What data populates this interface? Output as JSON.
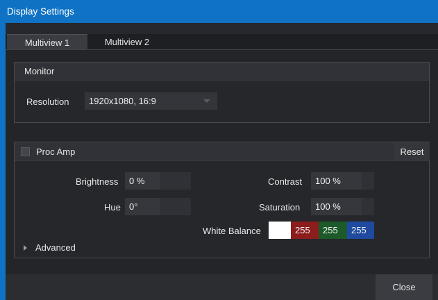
{
  "window": {
    "title": "Display Settings"
  },
  "tabs": [
    {
      "label": "Multiview 1",
      "active": true
    },
    {
      "label": "Multiview 2",
      "active": false
    }
  ],
  "monitor": {
    "title": "Monitor",
    "resolution_label": "Resolution",
    "resolution_value": "1920x1080, 16:9"
  },
  "proc_amp": {
    "title": "Proc Amp",
    "enabled": false,
    "reset_label": "Reset",
    "brightness_label": "Brightness",
    "brightness_value": "0 %",
    "contrast_label": "Contrast",
    "contrast_value": "100 %",
    "hue_label": "Hue",
    "hue_value": "0°",
    "saturation_label": "Saturation",
    "saturation_value": "100 %",
    "white_balance_label": "White Balance",
    "white_balance": {
      "swatch_color": "#ffffff",
      "red": "255",
      "green": "255",
      "blue": "255",
      "red_color": "#8b1d1d",
      "green_color": "#1d5a2a",
      "blue_color": "#1f4aa0"
    },
    "advanced_label": "Advanced"
  },
  "footer": {
    "close_label": "Close"
  },
  "colors": {
    "accent": "#0f72c4",
    "background": "#26282d"
  }
}
